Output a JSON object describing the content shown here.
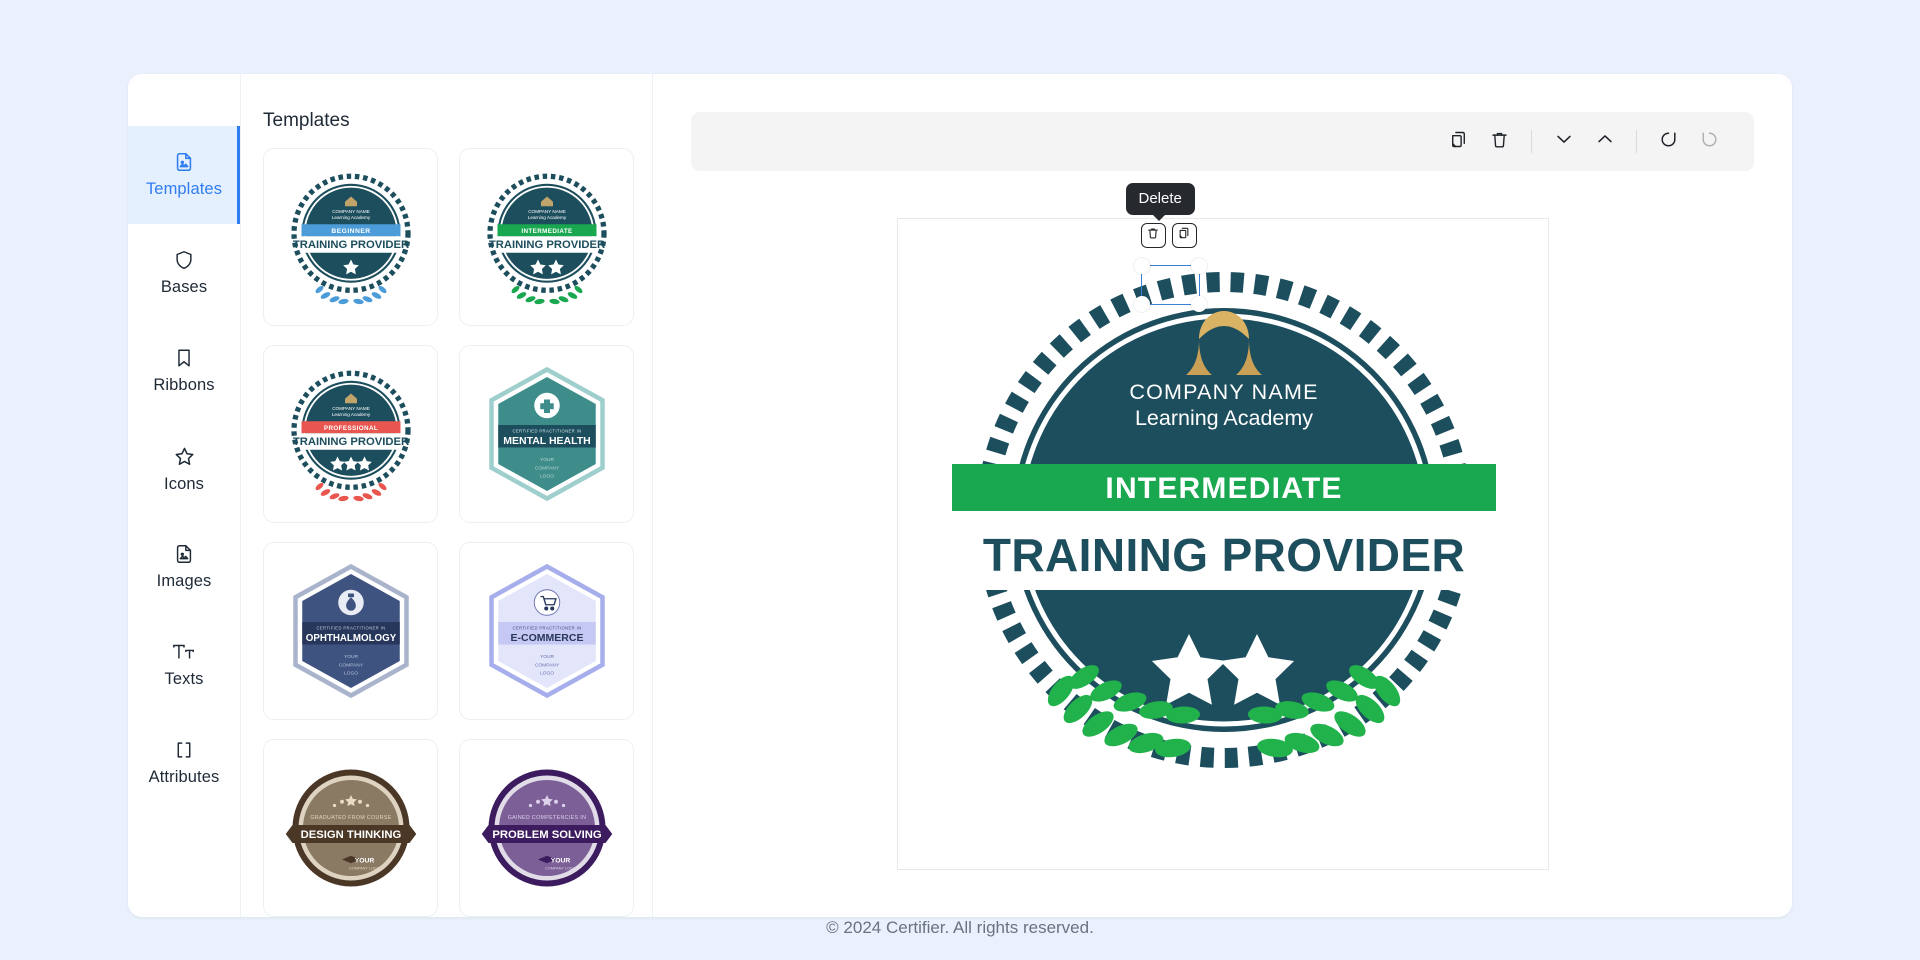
{
  "theme": {
    "page_bg": "#eaf1fc",
    "accent": "#2f7df0",
    "badge_teal": "#1d4e5e",
    "badge_green": "#19a74f",
    "badge_gold": "#d9b264",
    "tooltip_bg": "#26292e"
  },
  "sidebar": {
    "items": [
      {
        "label": "Templates",
        "icon": "document-image-icon",
        "active": true
      },
      {
        "label": "Bases",
        "icon": "shield-icon",
        "active": false
      },
      {
        "label": "Ribbons",
        "icon": "bookmark-icon",
        "active": false
      },
      {
        "label": "Icons",
        "icon": "star-icon",
        "active": false
      },
      {
        "label": "Images",
        "icon": "document-image-icon",
        "active": false
      },
      {
        "label": "Texts",
        "icon": "text-size-icon",
        "active": false
      },
      {
        "label": "Attributes",
        "icon": "brackets-icon",
        "active": false
      }
    ]
  },
  "panel": {
    "title": "Templates",
    "templates": [
      {
        "id": "beginner-training-provider",
        "style": "circle",
        "level": "BEGINNER",
        "title": "TRAINING PROVIDER",
        "band_color": "#4b9cd8",
        "body_color": "#1d4e5e",
        "laurel_color": "#4b9cd8",
        "stars": 1,
        "company_name": "COMPANY NAME",
        "company_sub": "Learning Academy"
      },
      {
        "id": "intermediate-training-provider",
        "style": "circle",
        "level": "INTERMEDIATE",
        "title": "TRAINING PROVIDER",
        "band_color": "#19a74f",
        "body_color": "#1d4e5e",
        "laurel_color": "#19a74f",
        "stars": 2,
        "company_name": "COMPANY NAME",
        "company_sub": "Learning Academy"
      },
      {
        "id": "professional-training-provider",
        "style": "circle",
        "level": "PROFESSIONAL",
        "title": "TRAINING PROVIDER",
        "band_color": "#e8564f",
        "body_color": "#1d4e5e",
        "laurel_color": "#e8564f",
        "stars": 3,
        "company_name": "COMPANY NAME",
        "company_sub": "Learning Academy"
      },
      {
        "id": "mental-health",
        "style": "hexagon",
        "level": "CERTIFIED PRACTITIONER IN",
        "title": "MENTAL HEALTH",
        "band_color": "#1d4e5e",
        "body_color": "#3e8d8b",
        "icon": "medical-cross-icon",
        "logo_text": "YOUR COMPANY LOGO"
      },
      {
        "id": "ophthalmology",
        "style": "hexagon",
        "level": "CERTIFIED PRACTITIONER IN",
        "title": "OPHTHALMOLOGY",
        "band_color": "#27365b",
        "body_color": "#3f5380",
        "icon": "eye-drop-icon",
        "logo_text": "YOUR COMPANY LOGO"
      },
      {
        "id": "e-commerce",
        "style": "hexagon",
        "level": "CERTIFIED PRACTITIONER IN",
        "title": "E-COMMERCE",
        "band_color": "#c5c8f2",
        "body_color": "#e3e5fb",
        "icon": "shopping-cart-icon",
        "logo_text": "YOUR COMPANY LOGO",
        "text_color": "#27365b"
      },
      {
        "id": "design-thinking",
        "style": "ribbon",
        "level": "GRADUATED FROM COURSE",
        "title": "DESIGN THINKING",
        "band_color": "#4a3726",
        "body_color": "#8a7963",
        "ring_color": "#4a3726",
        "logo_text": "YOUR COMPANY LOGO"
      },
      {
        "id": "problem-solving",
        "style": "ribbon",
        "level": "GAINED COMPETENCIES IN",
        "title": "PROBLEM SOLVING",
        "band_color": "#3c1b5e",
        "body_color": "#7b5f96",
        "ring_color": "#3c1b5e",
        "logo_text": "YOUR COMPANY LOGO"
      }
    ]
  },
  "toolbar": {
    "buttons": [
      {
        "name": "duplicate",
        "icon": "copy-icon",
        "disabled": false
      },
      {
        "name": "delete",
        "icon": "trash-icon",
        "disabled": false
      },
      {
        "name": "move-down",
        "icon": "chevron-down-icon",
        "disabled": false
      },
      {
        "name": "move-up",
        "icon": "chevron-up-icon",
        "disabled": false
      },
      {
        "name": "undo",
        "icon": "undo-icon",
        "disabled": false
      },
      {
        "name": "redo",
        "icon": "redo-icon",
        "disabled": true
      }
    ]
  },
  "canvas": {
    "tooltip": "Delete",
    "element_toolbar": [
      {
        "name": "delete",
        "icon": "trash-icon"
      },
      {
        "name": "duplicate",
        "icon": "copy-icon"
      }
    ],
    "badge": {
      "company_name": "COMPANY NAME",
      "company_sub": "Learning Academy",
      "level": "INTERMEDIATE",
      "title": "TRAINING PROVIDER",
      "stars": 2,
      "logo_icon": "arch-logo-icon"
    }
  },
  "footer": {
    "copyright": "© 2024 Certifier. All rights reserved."
  }
}
